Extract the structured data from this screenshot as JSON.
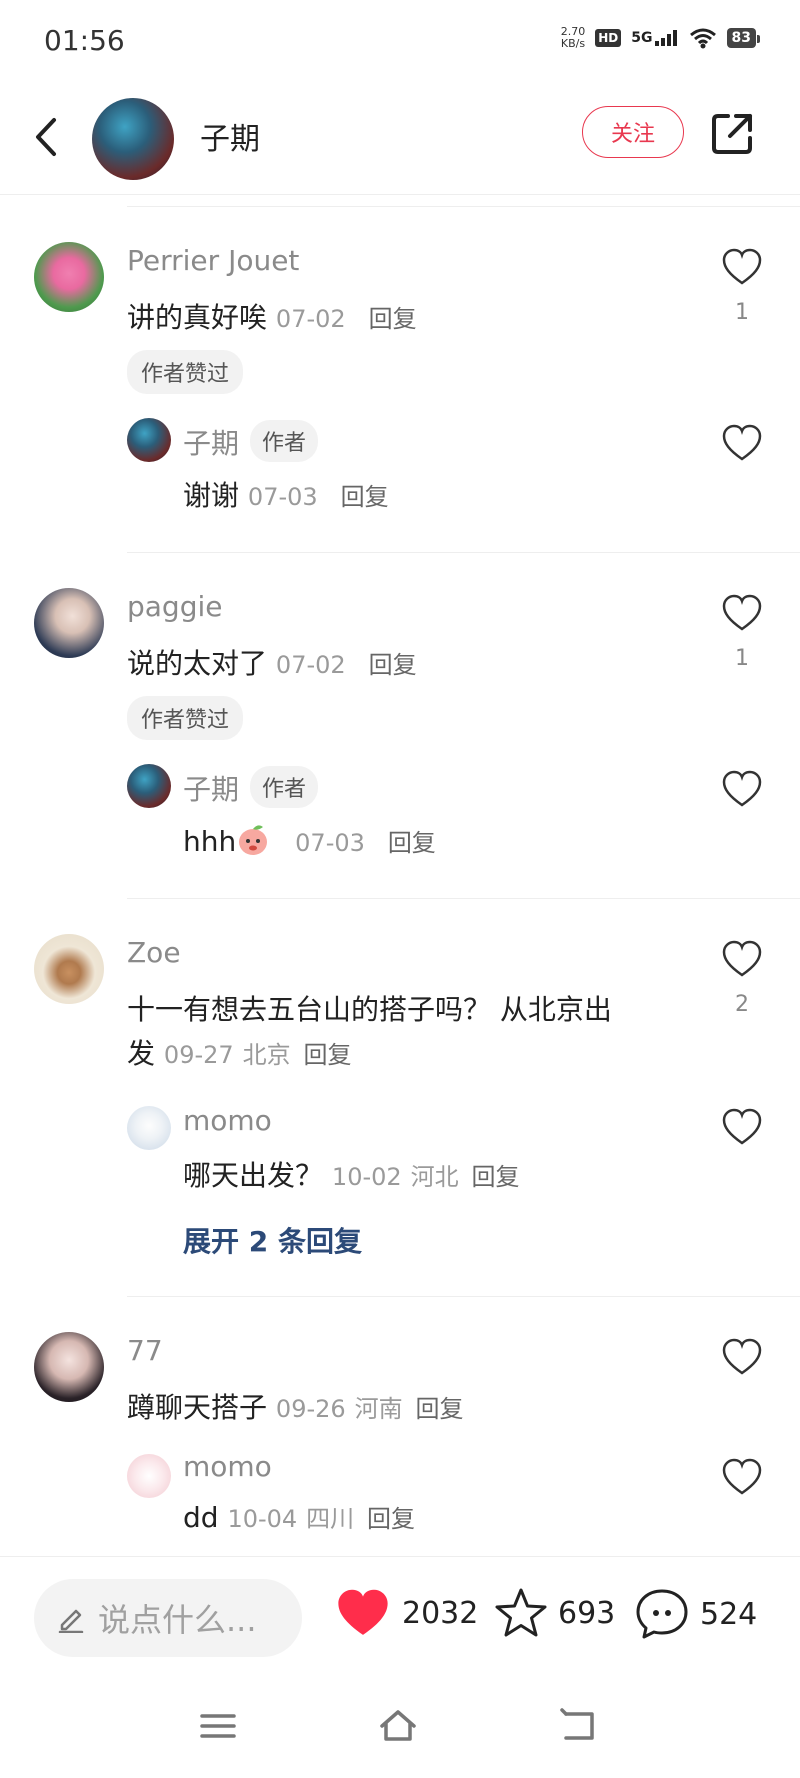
{
  "status_bar": {
    "time": "01:56",
    "net_speed_value": "2.70",
    "net_speed_unit": "KB/s",
    "hd": "HD",
    "network": "5G",
    "battery": "83"
  },
  "header": {
    "author_name": "子期",
    "follow_label": "关注"
  },
  "comments": [
    {
      "user": "Perrier Jouet",
      "text": "讲的真好唉",
      "date": "07-02",
      "location": "",
      "reply_label": "回复",
      "likes": "1",
      "tag": "作者赞过",
      "replies": [
        {
          "user": "子期",
          "badge": "作者",
          "text": "谢谢",
          "date": "07-03",
          "location": "",
          "reply_label": "回复"
        }
      ]
    },
    {
      "user": "paggie",
      "text": "说的太对了",
      "date": "07-02",
      "location": "",
      "reply_label": "回复",
      "likes": "1",
      "tag": "作者赞过",
      "replies": [
        {
          "user": "子期",
          "badge": "作者",
          "text": "hhh",
          "date": "07-03",
          "location": "",
          "reply_label": "回复"
        }
      ]
    },
    {
      "user": "Zoe",
      "text_line1": "十一有想去五台山的搭子吗？ 从北京出",
      "text_line2": "发",
      "date": "09-27",
      "location": "北京",
      "reply_label": "回复",
      "likes": "2",
      "replies": [
        {
          "user": "momo",
          "text": "哪天出发？",
          "date": "10-02",
          "location": "河北",
          "reply_label": "回复"
        }
      ],
      "expand_label": "展开 2 条回复"
    },
    {
      "user": "77",
      "text": "蹲聊天搭子",
      "date": "09-26",
      "location": "河南",
      "reply_label": "回复",
      "likes": "",
      "replies": [
        {
          "user": "momo",
          "text": "dd",
          "date": "10-04",
          "location": "四川",
          "reply_label": "回复"
        }
      ]
    }
  ],
  "bottom_bar": {
    "input_placeholder": "说点什么...",
    "likes": "2032",
    "favorites": "693",
    "comments": "524"
  },
  "colors": {
    "accent_red": "#e8384f",
    "heart_red": "#ff2d4b",
    "expand_blue": "#2c4a78"
  },
  "icons": [
    "back-icon",
    "share-icon",
    "heart-icon",
    "star-icon",
    "comment-icon",
    "pencil-icon",
    "menu-icon",
    "home-icon",
    "back-nav-icon"
  ]
}
